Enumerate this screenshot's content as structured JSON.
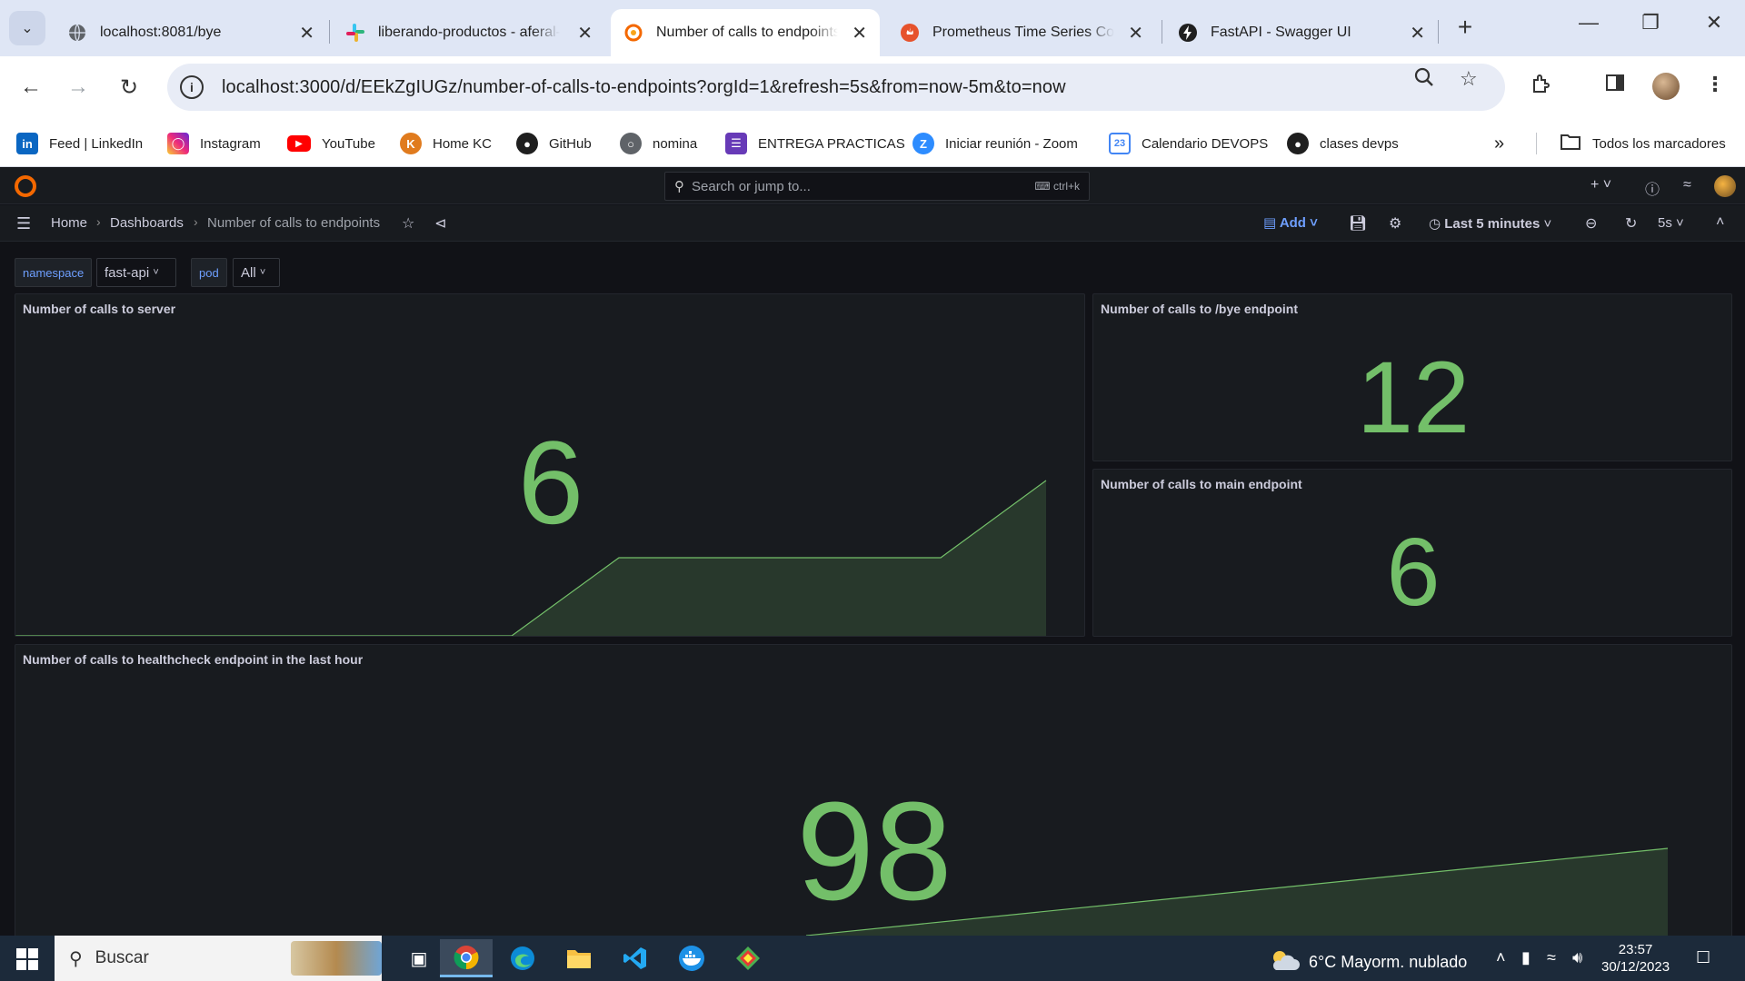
{
  "browser": {
    "tabs": [
      {
        "label": "localhost:8081/bye",
        "icon": "globe-icon",
        "active": false
      },
      {
        "label": "liberando-productos - aferal-",
        "icon": "slack-icon",
        "active": false
      },
      {
        "label": "Number of calls to endpoints",
        "icon": "grafana-icon",
        "active": true
      },
      {
        "label": "Prometheus Time Series Colle",
        "icon": "prometheus-icon",
        "active": false
      },
      {
        "label": "FastAPI - Swagger UI",
        "icon": "fastapi-icon",
        "active": false
      }
    ],
    "url": "localhost:3000/d/EEkZgIUGz/number-of-calls-to-endpoints?orgId=1&refresh=5s&from=now-5m&to=now",
    "bookmarks": [
      {
        "label": "Feed | LinkedIn",
        "icon": "linkedin-icon",
        "color": "#0a66c2"
      },
      {
        "label": "Instagram",
        "icon": "instagram-icon",
        "color": "#d6249f"
      },
      {
        "label": "YouTube",
        "icon": "youtube-icon",
        "color": "#ff0000"
      },
      {
        "label": "Home KC",
        "icon": "keepcoding-icon",
        "color": "#e07b1e"
      },
      {
        "label": "GitHub",
        "icon": "github-icon",
        "color": "#1f1f1f"
      },
      {
        "label": "nomina",
        "icon": "globe-icon",
        "color": "#5f6368"
      },
      {
        "label": "ENTREGA PRACTICAS",
        "icon": "forms-icon",
        "color": "#673ab7"
      },
      {
        "label": "Iniciar reunión - Zoom",
        "icon": "zoom-icon",
        "color": "#2d8cff"
      },
      {
        "label": "Calendario DEVOPS",
        "icon": "calendar-icon",
        "color": "#4285f4"
      },
      {
        "label": "clases devps",
        "icon": "octocat-icon",
        "color": "#1f1f1f"
      }
    ],
    "all_bookmarks_label": "Todos los marcadores"
  },
  "grafana": {
    "search_placeholder": "Search or jump to...",
    "search_shortcut": "ctrl+k",
    "breadcrumbs": [
      "Home",
      "Dashboards",
      "Number of calls to endpoints"
    ],
    "add_label": "Add",
    "time_range": "Last 5 minutes",
    "refresh_interval": "5s",
    "variables": [
      {
        "name": "namespace",
        "value": "fast-api"
      },
      {
        "name": "pod",
        "value": "All"
      }
    ],
    "accent_color": "#73bf69",
    "panels": [
      {
        "title": "Number of calls to server",
        "value": "6"
      },
      {
        "title": "Number of calls to /bye endpoint",
        "value": "12"
      },
      {
        "title": "Number of calls to main endpoint",
        "value": "6"
      },
      {
        "title": "Number of calls to healthcheck endpoint in the last hour",
        "value": "98"
      }
    ]
  },
  "taskbar": {
    "search_label": "Buscar",
    "weather": "6°C  Mayorm. nublado",
    "time": "23:57",
    "date": "30/12/2023"
  }
}
